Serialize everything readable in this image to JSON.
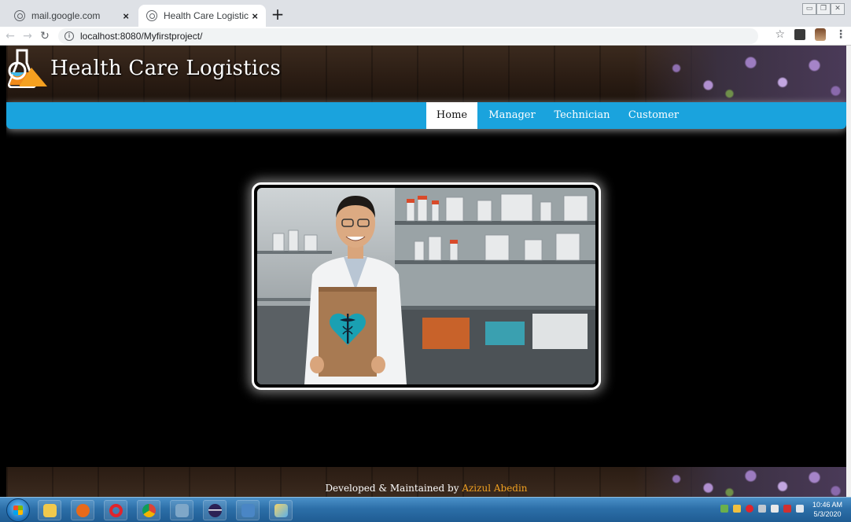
{
  "browser": {
    "tabs": [
      {
        "title": "mail.google.com"
      },
      {
        "title": "Health Care Logistics"
      }
    ],
    "address": "localhost:8080/Myfirstproject/"
  },
  "site": {
    "title": "Health Care Logistics",
    "nav": [
      {
        "label": "Home",
        "active": true
      },
      {
        "label": "Manager"
      },
      {
        "label": "Technician"
      },
      {
        "label": "Customer"
      }
    ],
    "footer": {
      "prefix": "Developed & Maintained by ",
      "author": "Azizul Abedin"
    }
  },
  "taskbar": {
    "time": "10:46 AM",
    "date": "5/3/2020"
  },
  "colors": {
    "navbar": "#1aa3dd",
    "footer_author": "#f0a020",
    "page_bg": "#000000"
  },
  "icons": [
    "info-icon",
    "star-icon",
    "flask-logo-icon",
    "heart-caduceus-icon",
    "windows-start-icon"
  ]
}
